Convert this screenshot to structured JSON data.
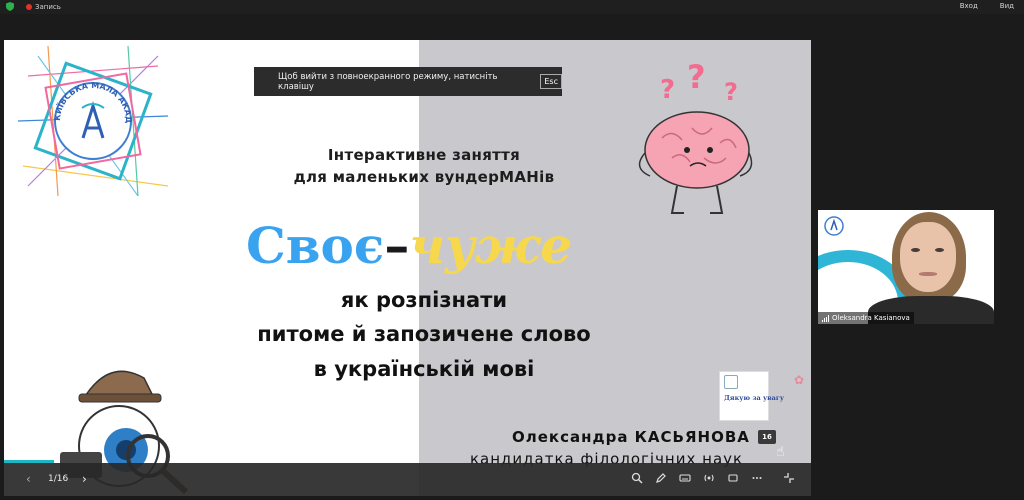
{
  "topbar": {
    "recording_label": "Запись",
    "login_label": "Вход",
    "view_label": "Вид"
  },
  "banner": {
    "text": "Щоб вийти з повноекранного режиму, натисніть клавішу",
    "key": "Esc"
  },
  "slide": {
    "subtitle_line1": "Інтерактивне заняття",
    "subtitle_line2": "для маленьких вундерМАНів",
    "heading_word1": "Своє",
    "heading_dash": "–",
    "heading_word2": "чуже",
    "body_line1": "як розпізнати",
    "body_line2": "питоме й запозичене слово",
    "body_line3": "в українській мові",
    "author_name": "Олександра КАСЬЯНОВА",
    "author_title": "кандидатка філологічних наук",
    "logo_text": "КИЇВСЬКА МАЛА АКАДЕМІЯ НАУК",
    "thumbnail_text": "Дякую за увагу",
    "thumbnail_count": "16"
  },
  "toolbar": {
    "page_indicator": "1/16",
    "prev_glyph": "‹",
    "next_glyph": "›"
  },
  "video": {
    "participant_name": "Oleksandra Kasianova"
  },
  "colors": {
    "heading_blue": "#3aa3f0",
    "heading_yellow": "#f7d84c",
    "accent_teal": "#1fb6c4",
    "record_red": "#e0332b"
  }
}
